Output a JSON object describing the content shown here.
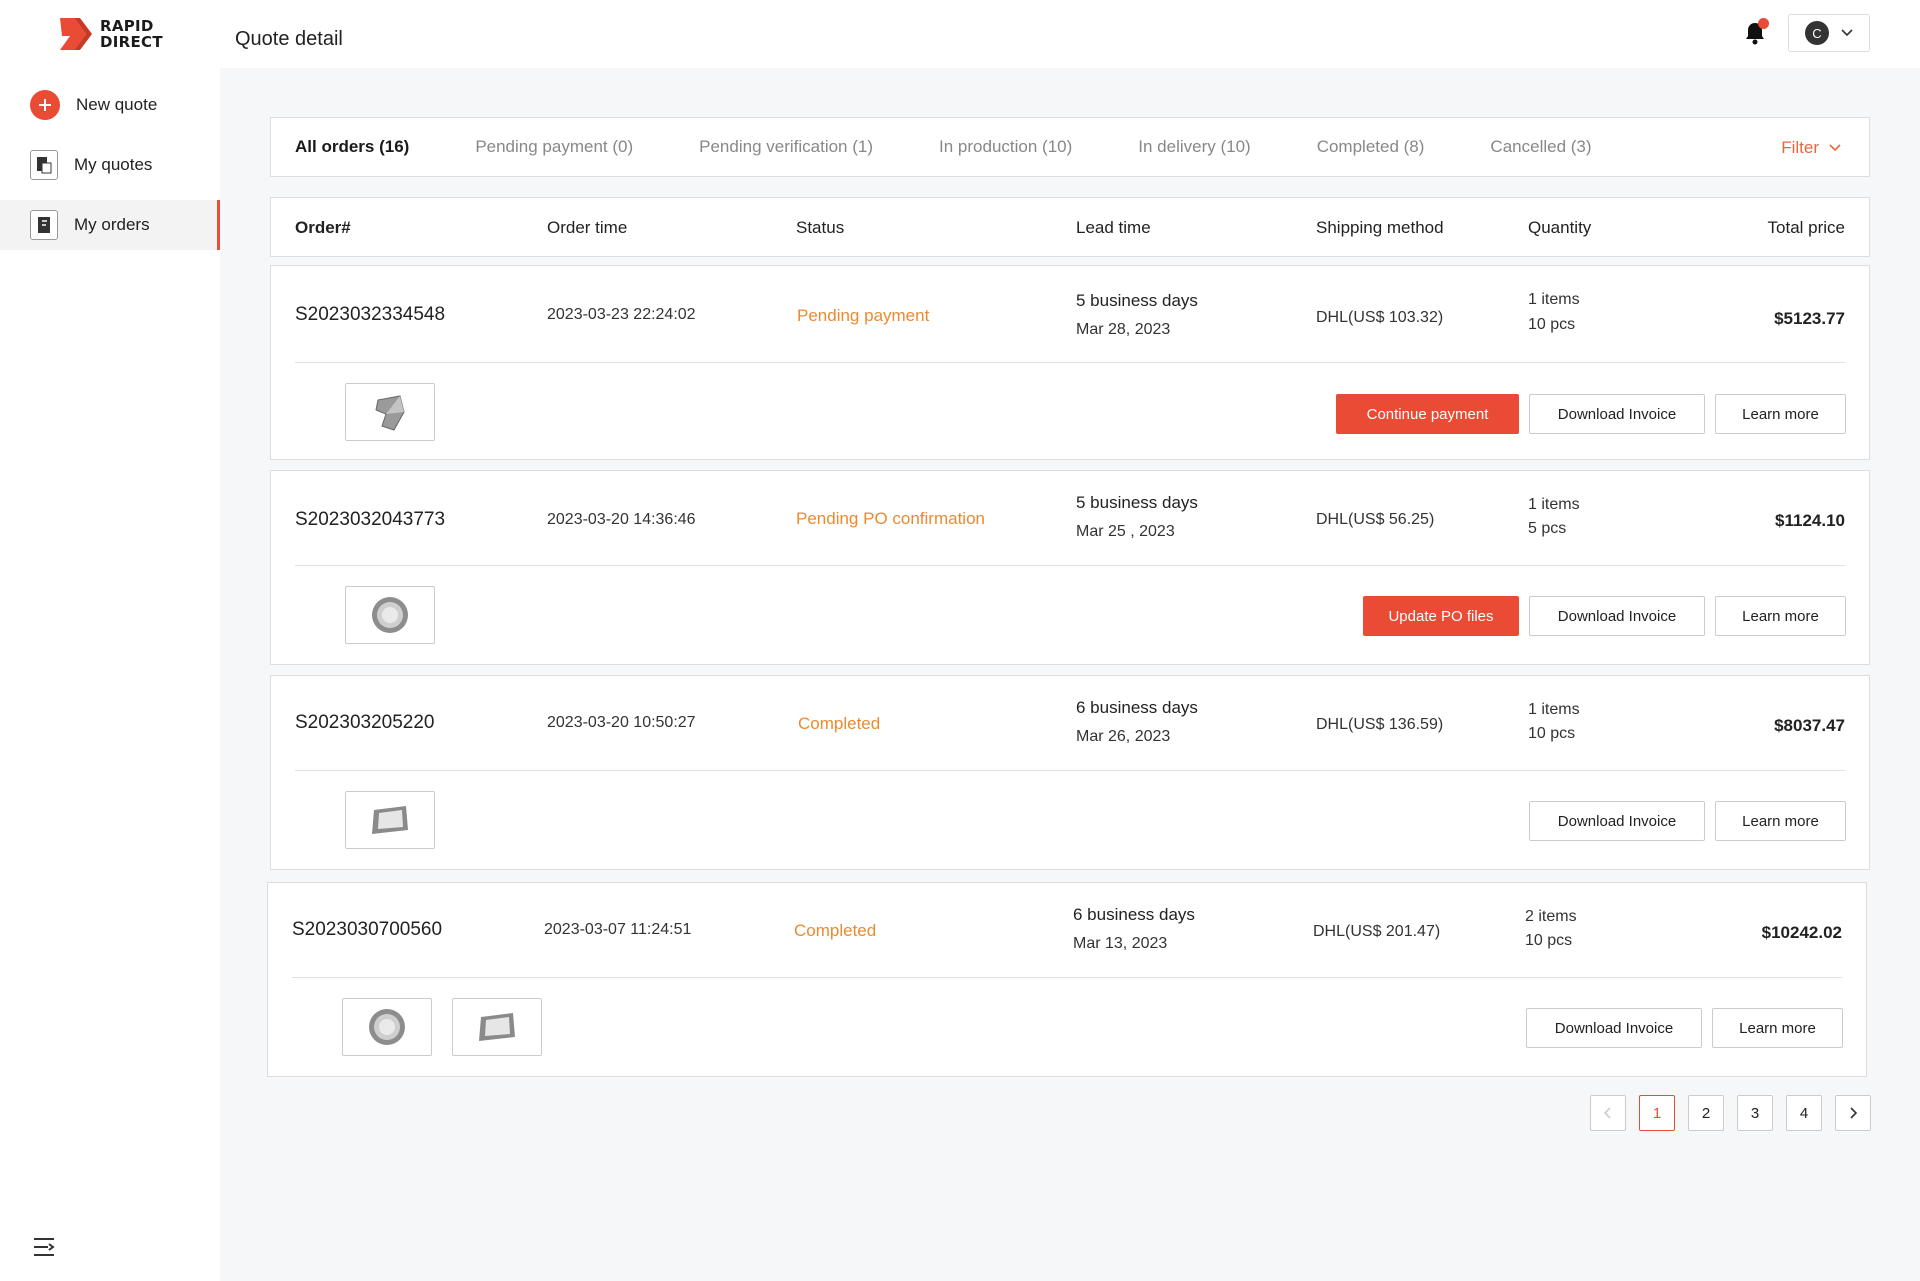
{
  "brand": {
    "line1": "RAPID",
    "line2": "DIRECT",
    "color": "#e94b35"
  },
  "sidebar": {
    "items": [
      {
        "label": "New quote",
        "icon": "plus-circle-icon"
      },
      {
        "label": "My quotes",
        "icon": "quote-doc-icon"
      },
      {
        "label": "My orders",
        "icon": "order-doc-icon",
        "active": true
      }
    ]
  },
  "header": {
    "title": "Quote detail",
    "avatar_initial": "C"
  },
  "tabs": [
    {
      "label": "All orders (16)",
      "active": true
    },
    {
      "label": "Pending payment (0)"
    },
    {
      "label": "Pending verification (1)"
    },
    {
      "label": "In production (10)"
    },
    {
      "label": "In delivery (10)"
    },
    {
      "label": "Completed (8)"
    },
    {
      "label": "Cancelled (3)"
    }
  ],
  "filter_label": "Filter",
  "columns": {
    "order": "Order#",
    "time": "Order time",
    "status": "Status",
    "lead": "Lead time",
    "shipping": "Shipping method",
    "quantity": "Quantity",
    "total": "Total price"
  },
  "orders": [
    {
      "id": "S2023032334548",
      "time": "2023-03-23 22:24:02",
      "status": "Pending payment",
      "lead_days": "5 business days",
      "lead_date": "Mar 28, 2023",
      "shipping": "DHL(US$ 103.32)",
      "items": "1 items",
      "pcs": "10 pcs",
      "total": "$5123.77",
      "primary_action": "Continue payment",
      "invoice": "Download Invoice",
      "more": "Learn more"
    },
    {
      "id": "S2023032043773",
      "time": "2023-03-20 14:36:46",
      "status": "Pending PO confirmation",
      "lead_days": "5 business days",
      "lead_date": "Mar 25 , 2023",
      "shipping": "DHL(US$ 56.25)",
      "items": "1 items",
      "pcs": "5 pcs",
      "total": "$1124.10",
      "primary_action": "Update PO files",
      "invoice": "Download Invoice",
      "more": "Learn more"
    },
    {
      "id": "S202303205220",
      "time": "2023-03-20 10:50:27",
      "status": "Completed",
      "lead_days": "6 business days",
      "lead_date": "Mar 26, 2023",
      "shipping": "DHL(US$ 136.59)",
      "items": "1 items",
      "pcs": "10 pcs",
      "total": "$8037.47",
      "invoice": "Download Invoice",
      "more": "Learn more"
    },
    {
      "id": "S2023030700560",
      "time": "2023-03-07 11:24:51",
      "status": "Completed",
      "lead_days": "6 business days",
      "lead_date": "Mar 13, 2023",
      "shipping": "DHL(US$ 201.47)",
      "items": "2 items",
      "pcs": "10 pcs",
      "total": "$10242.02",
      "invoice": "Download Invoice",
      "more": "Learn more"
    }
  ],
  "pagination": {
    "pages": [
      "1",
      "2",
      "3",
      "4"
    ],
    "current": "1"
  },
  "colors": {
    "accent": "#e94b35",
    "status_orange": "#ec8a30"
  }
}
